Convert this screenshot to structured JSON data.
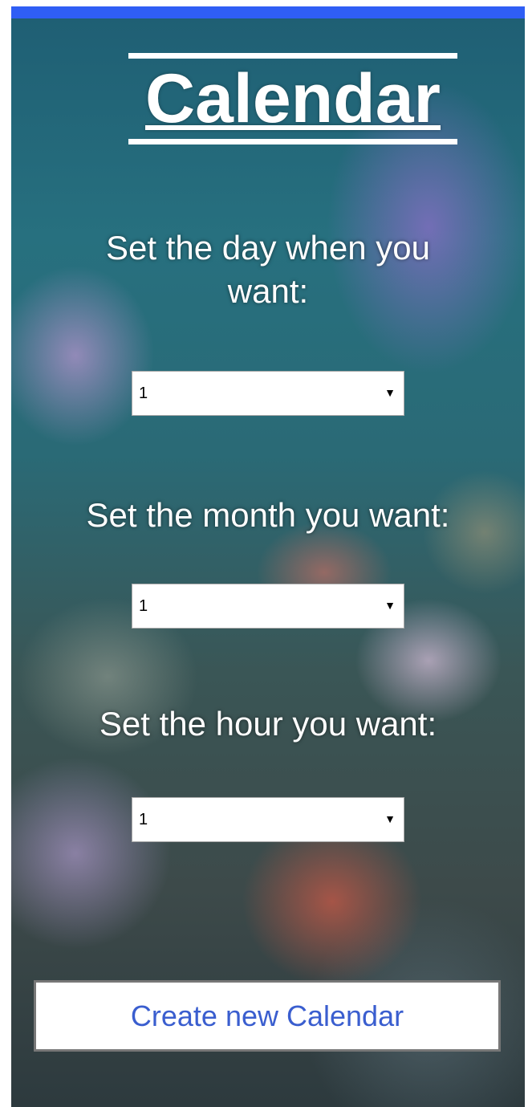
{
  "header": {
    "title": "Calendar"
  },
  "form": {
    "day_label": "Set the day when you want:",
    "day_value": "1",
    "month_label": "Set the month you want:",
    "month_value": "1",
    "hour_label": "Set the hour you want:",
    "hour_value": "1",
    "create_button_label": "Create new Calendar"
  },
  "colors": {
    "top_bar": "#2f5ef5",
    "button_text": "#3a5ecf"
  }
}
